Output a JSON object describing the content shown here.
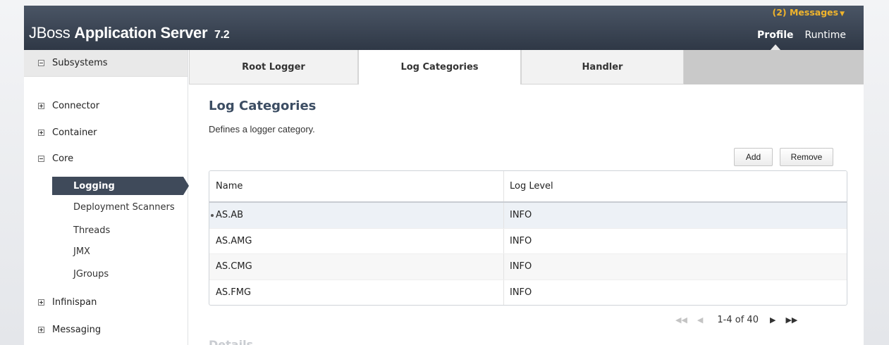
{
  "header": {
    "brand_light": "JBoss",
    "brand_bold": "Application Server",
    "brand_version": "7.2",
    "messages": "(2) Messages",
    "nav": {
      "profile": "Profile",
      "runtime": "Runtime"
    }
  },
  "sidebar": {
    "title": "Subsystems",
    "groups": {
      "connector": "Connector",
      "container": "Container",
      "core": "Core",
      "infinispan": "Infinispan",
      "messaging": "Messaging"
    },
    "core_items": {
      "logging": "Logging",
      "deployment_scanners": "Deployment Scanners",
      "threads": "Threads",
      "jmx": "JMX",
      "jgroups": "JGroups"
    }
  },
  "tabs": {
    "root_logger": "Root Logger",
    "log_categories": "Log Categories",
    "handler": "Handler"
  },
  "main": {
    "title": "Log Categories",
    "description": "Defines a logger category.",
    "add_label": "Add",
    "remove_label": "Remove",
    "table": {
      "col_name": "Name",
      "col_level": "Log Level",
      "rows": [
        {
          "name": "AS.AB",
          "level": "INFO"
        },
        {
          "name": "AS.AMG",
          "level": "INFO"
        },
        {
          "name": "AS.CMG",
          "level": "INFO"
        },
        {
          "name": "AS.FMG",
          "level": "INFO"
        }
      ]
    },
    "pager": {
      "range": "1-4 of 40"
    },
    "details_title": "Details"
  },
  "colors": {
    "header_bg": "#2f3846",
    "accent_orange": "#f0b42c",
    "title_blue": "#3c4d63",
    "active_nav": "#3f4a5a"
  }
}
